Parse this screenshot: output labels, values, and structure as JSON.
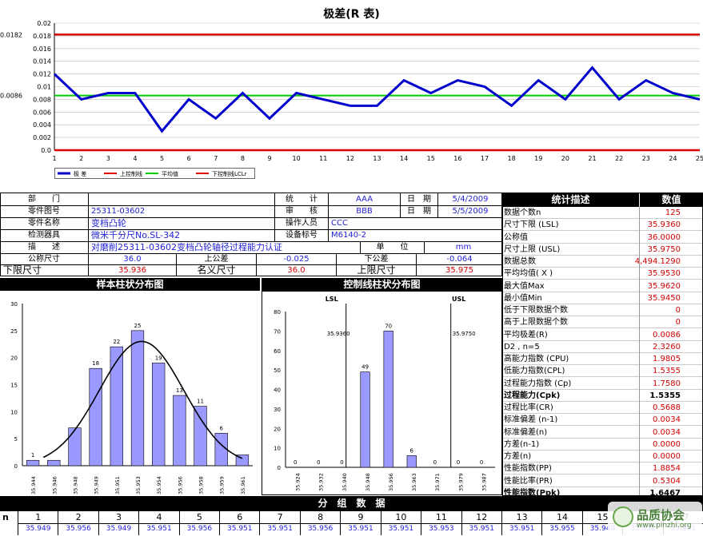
{
  "range_chart": {
    "title": "极差(R 表)",
    "ucl_label": "0.0182",
    "mean_label": "0.0086",
    "legend": [
      "极 差",
      "上控制线",
      "平均值",
      "下控制线LCLr"
    ],
    "chart_data": {
      "type": "line",
      "x": [
        1,
        2,
        3,
        4,
        5,
        6,
        7,
        8,
        9,
        10,
        11,
        12,
        13,
        14,
        15,
        16,
        17,
        18,
        19,
        20,
        21,
        22,
        23,
        24,
        25
      ],
      "series": [
        {
          "name": "极 差",
          "values": [
            0.012,
            0.008,
            0.009,
            0.009,
            0.003,
            0.008,
            0.005,
            0.009,
            0.005,
            0.009,
            0.008,
            0.007,
            0.007,
            0.011,
            0.009,
            0.011,
            0.01,
            0.007,
            0.011,
            0.008,
            0.013,
            0.008,
            0.011,
            0.009,
            0.008
          ]
        },
        {
          "name": "上控制线",
          "values": [
            0.0182
          ]
        },
        {
          "name": "平均值",
          "values": [
            0.0086
          ]
        },
        {
          "name": "下控制线LCLr",
          "values": [
            0
          ]
        }
      ],
      "ylim": [
        0,
        0.02
      ],
      "yticks": [
        "0.02",
        "0.018",
        "0.016",
        "0.014",
        "0.012",
        "0.01",
        "0.008",
        "0.006",
        "0.004",
        "0.002",
        "0.0"
      ],
      "xticks": [
        "1",
        "2",
        "3",
        "4",
        "5",
        "6",
        "7",
        "8",
        "9",
        "10",
        "11",
        "12",
        "13",
        "14",
        "15",
        "16",
        "17",
        "18",
        "19",
        "20",
        "21",
        "22",
        "23",
        "24",
        "25"
      ],
      "colors": {
        "range": "#0000cc",
        "ucl": "#dd0000",
        "mean": "#00cc00",
        "lcl": "#dd0000"
      }
    }
  },
  "info": {
    "dept_label": "部　　门",
    "part_no_label": "零件图号",
    "part_no": "25311-03602",
    "part_name_label": "零件名称",
    "part_name": "变档凸轮",
    "gauge_label": "检测器具",
    "gauge": "微米千分尺No.SL-342",
    "desc_label": "描　　述",
    "desc": "对磨削25311-03602变档凸轮轴径过程能力认证",
    "nominal_label": "公称尺寸",
    "nominal": "36.0",
    "upper_tol_label": "上公差",
    "upper_tol": "-0.025",
    "lower_tol_label": "下公差",
    "lower_tol": "-0.064",
    "lsl_label": "下限尺寸",
    "lsl": "35.936",
    "nominal2_label": "名义尺寸",
    "nominal2": "36.0",
    "usl_label": "上限尺寸",
    "usl": "35.975",
    "stat_label": "统　　计",
    "stat_person": "AAA",
    "review_label": "审　　核",
    "review_person": "BBB",
    "operator_label": "操作人员",
    "operator": "CCC",
    "device_label": "设备标号",
    "device": "M6140-2",
    "date_label": "日　期",
    "date1": "5/4/2009",
    "date2": "5/5/2009",
    "unit_label": "单　　位",
    "unit": "mm"
  },
  "stats": {
    "title": "统计描述",
    "value_title": "数值",
    "rows": [
      {
        "label": "数据个数n",
        "value": "125",
        "bold": false
      },
      {
        "label": "尺寸下限 (LSL)",
        "value": "35.9360",
        "bold": false
      },
      {
        "label": "公称值",
        "value": "36.0000",
        "bold": false
      },
      {
        "label": "尺寸上限 (USL)",
        "value": "35.9750",
        "bold": false
      },
      {
        "label": "数据总数",
        "value": "4,494.1290",
        "bold": false
      },
      {
        "label": "平均均值( X )",
        "value": "35.9530",
        "bold": false
      },
      {
        "label": "最大值Max",
        "value": "35.9620",
        "bold": false
      },
      {
        "label": "最小值Min",
        "value": "35.9450",
        "bold": false
      },
      {
        "label": "低于下限数据个数",
        "value": "0",
        "bold": false
      },
      {
        "label": "高于上限数据个数",
        "value": "0",
        "bold": false
      },
      {
        "label": "平均极差(R)",
        "value": "0.0086",
        "bold": false
      },
      {
        "label": "D2 , n=5",
        "value": "2.3260",
        "bold": false
      },
      {
        "label": "高能力指数 (CPU)",
        "value": "1.9805",
        "bold": false
      },
      {
        "label": "低能力指数(CPL)",
        "value": "1.5355",
        "bold": false
      },
      {
        "label": "过程能力指数 (Cp)",
        "value": "1.7580",
        "bold": false
      },
      {
        "label": "过程能力(Cpk)",
        "value": "1.5355",
        "bold": true
      },
      {
        "label": "过程比率(CR)",
        "value": "0.5688",
        "bold": false
      },
      {
        "label": "标准偏差 (n-1)",
        "value": "0.0034",
        "bold": false
      },
      {
        "label": "标准偏差(n)",
        "value": "0.0034",
        "bold": false
      },
      {
        "label": "方差(n-1)",
        "value": "0.0000",
        "bold": false
      },
      {
        "label": "方差(n)",
        "value": "0.0000",
        "bold": false
      },
      {
        "label": "性能指数(PP)",
        "value": "1.8854",
        "bold": false
      },
      {
        "label": "性能比率(PR)",
        "value": "0.5304",
        "bold": false
      },
      {
        "label": "性能指数(Ppk)",
        "value": "1.6467",
        "bold": true
      }
    ]
  },
  "sample_hist": {
    "title": "样本柱状分布图",
    "chart_data": {
      "type": "bar",
      "categories": [
        "35.944",
        "35.946",
        "35.948",
        "35.949",
        "35.951",
        "35.953",
        "35.954",
        "35.956",
        "35.958",
        "35.959",
        "35.961"
      ],
      "values": [
        1,
        1,
        7,
        18,
        22,
        25,
        19,
        13,
        11,
        6,
        2
      ],
      "labels": [
        "1",
        "",
        "",
        "18",
        "22",
        "25",
        "19",
        "13",
        "11",
        "6",
        ""
      ],
      "ylim": [
        0,
        30
      ],
      "yticks": [
        "30",
        "25",
        "20",
        "15",
        "10",
        "5",
        "0"
      ],
      "bar_color": "#9999ff"
    }
  },
  "control_hist": {
    "title": "控制线柱状分布图",
    "lsl_text": "LSL",
    "usl_text": "USL",
    "lsl_value": "35.9360",
    "usl_value": "35.9750",
    "chart_data": {
      "type": "bar",
      "categories": [
        "35.924",
        "35.932",
        "35.940",
        "35.948",
        "35.956",
        "35.963",
        "35.971",
        "35.979",
        "35.987"
      ],
      "values": [
        0,
        0,
        0,
        49,
        70,
        6,
        0,
        0,
        0
      ],
      "ylim": [
        0,
        80
      ],
      "yticks": [
        "80",
        "70",
        "60",
        "50",
        "40",
        "30",
        "20",
        "10",
        "0"
      ],
      "bar_color": "#9999ff"
    }
  },
  "group_data": {
    "title": "分　组　数　据",
    "n_label": "n",
    "cols": [
      "1",
      "2",
      "3",
      "4",
      "5",
      "6",
      "7",
      "8",
      "9",
      "10",
      "11",
      "12",
      "13",
      "14",
      "15",
      "16",
      "17"
    ],
    "row1": [
      "35.949",
      "35.956",
      "35.949",
      "35.951",
      "35.956",
      "35.951",
      "35.951",
      "35.956",
      "35.951",
      "35.951",
      "35.953",
      "35.951",
      "35.951",
      "35.955",
      "35.949",
      "35.951",
      "35.951"
    ]
  },
  "watermark": {
    "text": "品质协会",
    "url": "www.pinzhi.org"
  }
}
